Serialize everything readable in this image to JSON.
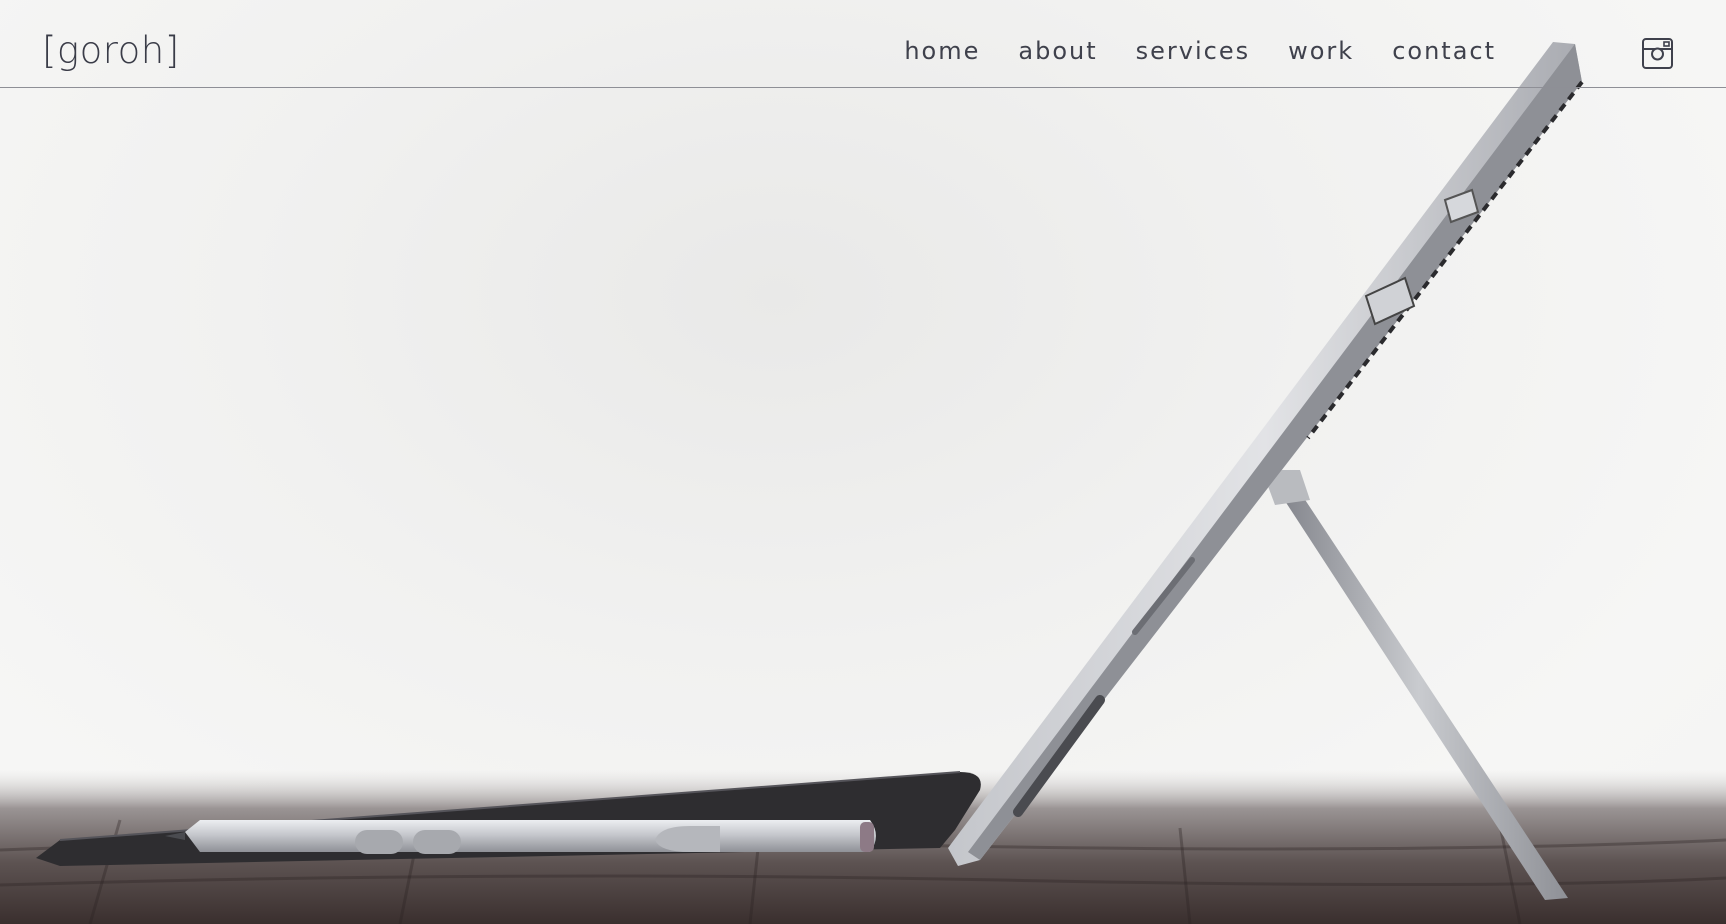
{
  "brand": {
    "logo_text": "[goroh]"
  },
  "nav": {
    "items": [
      {
        "label": "home"
      },
      {
        "label": "about"
      },
      {
        "label": "services"
      },
      {
        "label": "work"
      },
      {
        "label": "contact"
      }
    ]
  },
  "social": {
    "icon": "instagram-icon"
  },
  "colors": {
    "text": "#3f414c",
    "rule": "#8e8f96",
    "background": "#f3f3f2"
  }
}
